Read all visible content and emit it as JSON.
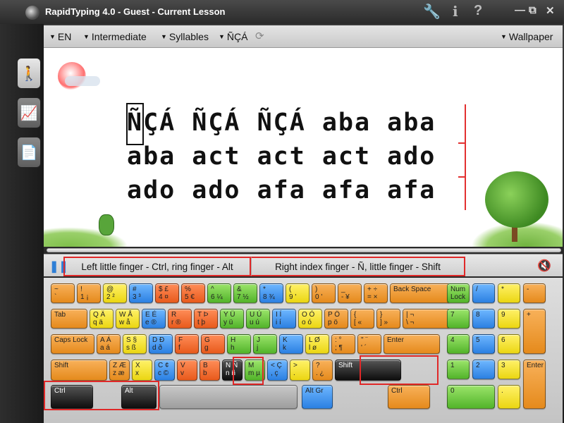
{
  "window": {
    "title": "RapidTyping 4.0 - Guest - Current Lesson"
  },
  "icons": {
    "tools": "wrench-icon",
    "info": "i",
    "help": "?",
    "min": "—",
    "max": "⧉",
    "close": "✕"
  },
  "toolbar": {
    "lang": "EN",
    "level": "Intermediate",
    "mode": "Syllables",
    "charset": "ÑÇÁ",
    "wallpaper": "Wallpaper"
  },
  "lesson": {
    "lines": [
      "ÑÇÁ ÑÇÁ ÑÇÁ aba aba",
      "aba act act act ado",
      "ado ado afa afa afa"
    ]
  },
  "hints": {
    "left": "Left little finger - Ctrl, ring finger - Alt",
    "right": "Right index finger - Ñ, little finger - Shift"
  },
  "keyboard": {
    "row1": [
      [
        "~",
        "`"
      ],
      [
        "!",
        "1 ¡"
      ],
      [
        "@",
        "2 ²"
      ],
      [
        "#",
        "3 ³"
      ],
      [
        "$ £",
        "4 ¤"
      ],
      [
        "%",
        "5 €"
      ],
      [
        "^",
        "6 ¼"
      ],
      [
        "&",
        "7 ½"
      ],
      [
        "*",
        "8 ¾"
      ],
      [
        "(",
        "9 '"
      ],
      [
        ")",
        "0 '"
      ],
      [
        "_",
        "- ¥"
      ],
      [
        "+ ÷",
        "= ×"
      ],
      [
        "Back Space",
        ""
      ]
    ],
    "row2": [
      [
        "Tab",
        ""
      ],
      [
        "Q Ä",
        "q ä"
      ],
      [
        "W Å",
        "w å"
      ],
      [
        "E É",
        "e ®"
      ],
      [
        "R",
        "r ®"
      ],
      [
        "T Þ",
        "t þ"
      ],
      [
        "Y Ü",
        "y ü"
      ],
      [
        "U Ú",
        "u ú"
      ],
      [
        "I Í",
        "i í"
      ],
      [
        "O Ó",
        "o ó"
      ],
      [
        "P Ö",
        "p ö"
      ],
      [
        "{",
        "[ «"
      ],
      [
        "}",
        "] »"
      ],
      [
        "| ¬",
        "\\ ¬"
      ]
    ],
    "row3": [
      [
        "Caps Lock",
        ""
      ],
      [
        "A Á",
        "a á"
      ],
      [
        "S §",
        "s ß"
      ],
      [
        "D Ð",
        "d ð"
      ],
      [
        "F",
        "f"
      ],
      [
        "G",
        "g"
      ],
      [
        "H",
        "h"
      ],
      [
        "J",
        "j"
      ],
      [
        "K",
        "k"
      ],
      [
        "L Ø",
        "l ø"
      ],
      [
        ": °",
        "; ¶"
      ],
      [
        "\" ¨",
        "' ´"
      ],
      [
        "Enter",
        ""
      ]
    ],
    "row4": [
      [
        "Shift",
        ""
      ],
      [
        "Z Æ",
        "z æ"
      ],
      [
        "X",
        "x"
      ],
      [
        "C ¢",
        "c ©"
      ],
      [
        "V",
        "v"
      ],
      [
        "B",
        "b"
      ],
      [
        "N Ñ",
        "n ñ"
      ],
      [
        "M",
        "m µ"
      ],
      [
        "< Ç",
        ", ç"
      ],
      [
        ">",
        "."
      ],
      [
        "? ",
        ". ¿"
      ],
      [
        "Shift",
        ""
      ]
    ],
    "row5": [
      [
        "Ctrl",
        ""
      ],
      [
        "Alt",
        ""
      ],
      [
        "",
        ""
      ],
      [
        "Alt Gr",
        ""
      ],
      [
        "Ctrl",
        ""
      ]
    ],
    "numpad": [
      [
        "Num Lock",
        ""
      ],
      [
        "/",
        ""
      ],
      [
        "*",
        ""
      ],
      [
        "-",
        ""
      ],
      [
        "7",
        ""
      ],
      [
        "8",
        ""
      ],
      [
        "9",
        ""
      ],
      [
        "+",
        ""
      ],
      [
        "4",
        ""
      ],
      [
        "5",
        ""
      ],
      [
        "6",
        ""
      ],
      [
        "1",
        ""
      ],
      [
        "2",
        ""
      ],
      [
        "3",
        ""
      ],
      [
        "Enter",
        ""
      ],
      [
        "0",
        ""
      ],
      [
        ".",
        ""
      ]
    ]
  }
}
